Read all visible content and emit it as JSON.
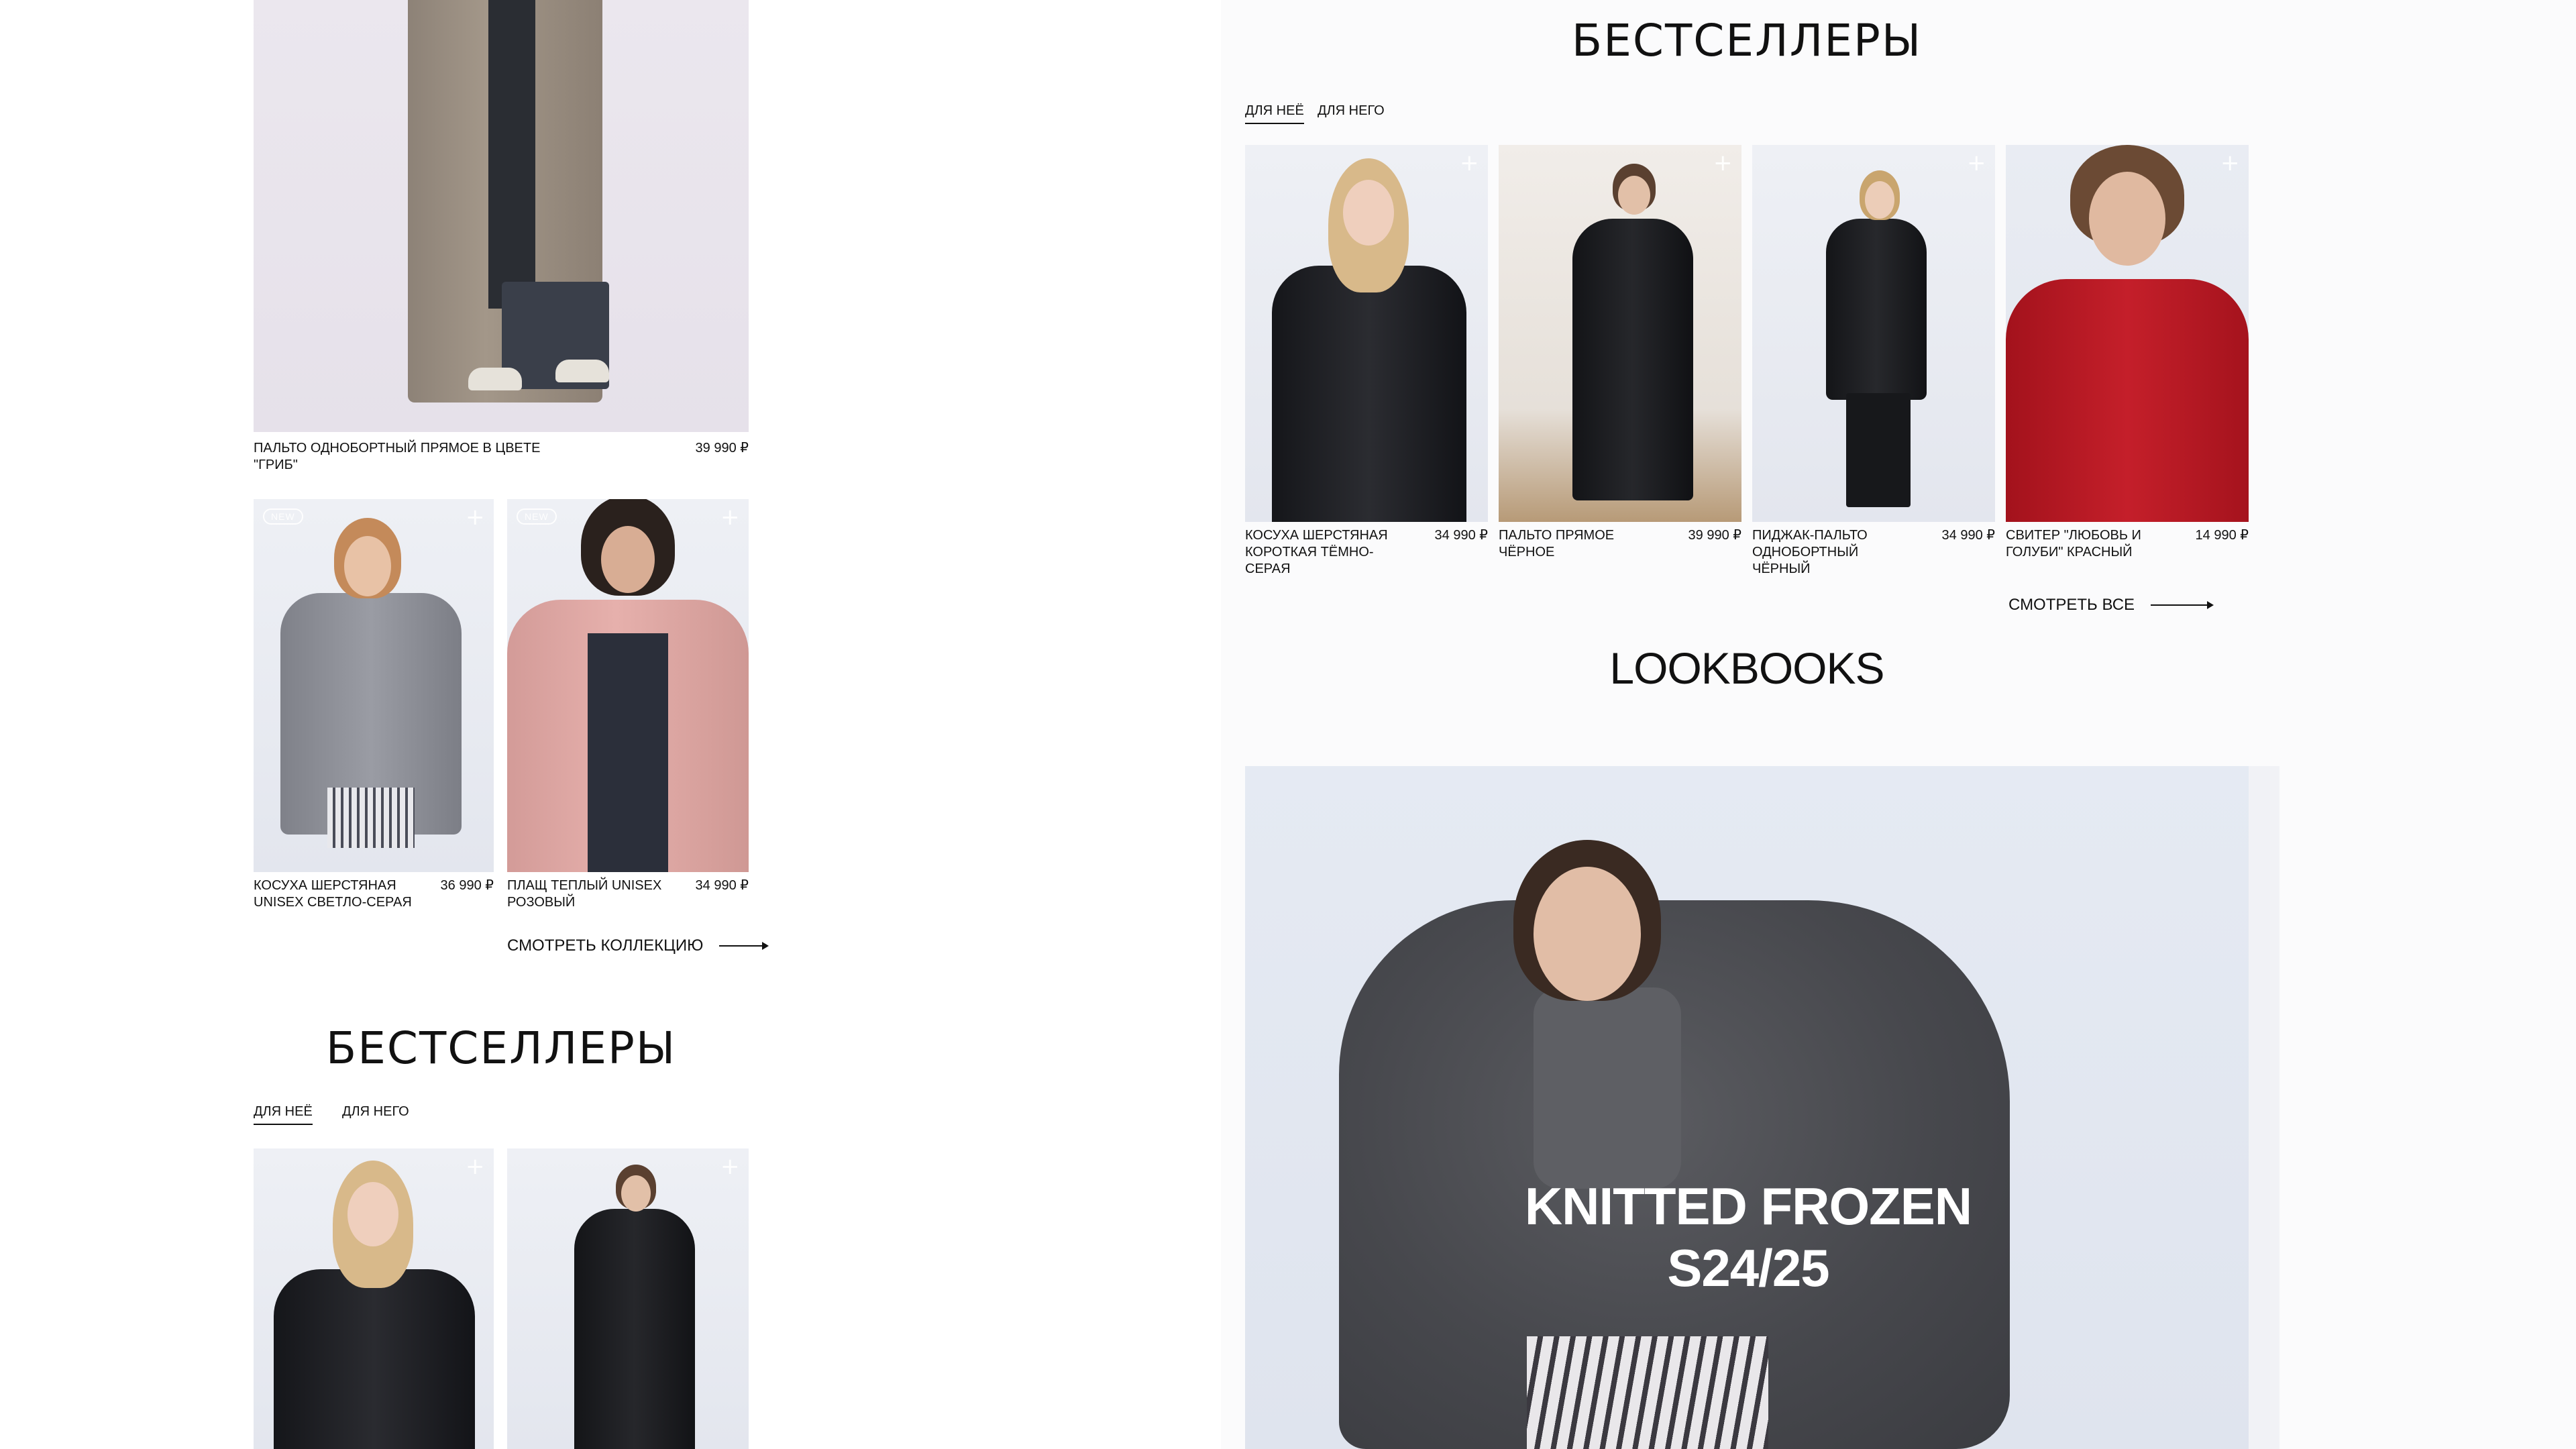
{
  "left": {
    "top_product": {
      "name": "ПАЛЬТО ОДНОБОРТНЫЙ ПРЯМОЕ В ЦВЕТЕ \"ГРИБ\"",
      "price": "39 990 ₽"
    },
    "products": [
      {
        "name": "КОСУХА ШЕРСТЯНАЯ UNISEX СВЕТЛО-СЕРАЯ",
        "price": "36 990 ₽",
        "badge": "NEW"
      },
      {
        "name": "ПЛАЩ ТЕПЛЫЙ UNISEX РОЗОВЫЙ",
        "price": "34 990 ₽",
        "badge": "NEW"
      }
    ],
    "see_collection": "СМОТРЕТЬ КОЛЛЕКЦИЮ",
    "bestsellers": {
      "title": "БЕСТСЕЛЛЕРЫ",
      "tabs": [
        "ДЛЯ НЕЁ",
        "ДЛЯ НЕГО"
      ]
    }
  },
  "right": {
    "bestsellers": {
      "title": "БЕСТСЕЛЛЕРЫ",
      "tabs": [
        "ДЛЯ НЕЁ",
        "ДЛЯ НЕГО"
      ],
      "products": [
        {
          "name": "КОСУХА ШЕРСТЯНАЯ КОРОТКАЯ ТЁМНО-СЕРАЯ",
          "price": "34 990 ₽"
        },
        {
          "name": "ПАЛЬТО ПРЯМОЕ ЧЁРНОЕ",
          "price": "39 990 ₽"
        },
        {
          "name": "ПИДЖАК-ПАЛЬТО ОДНОБОРТНЫЙ ЧЁРНЫЙ",
          "price": "34 990 ₽"
        },
        {
          "name": "СВИТЕР \"ЛЮБОВЬ И ГОЛУБИ\" КРАСНЫЙ",
          "price": "14 990 ₽"
        }
      ],
      "see_all": "СМОТРЕТЬ ВСЕ"
    },
    "lookbooks": {
      "title": "LOOKBOOKS",
      "feature_line1": "KNITTED FROZEN",
      "feature_line2": "S24/25"
    }
  },
  "icons": {
    "plus": "plus-icon",
    "arrow": "arrow-right-icon"
  },
  "colors": {
    "text": "#111111",
    "background": "#ffffff",
    "panel": "#fbfbfc"
  }
}
